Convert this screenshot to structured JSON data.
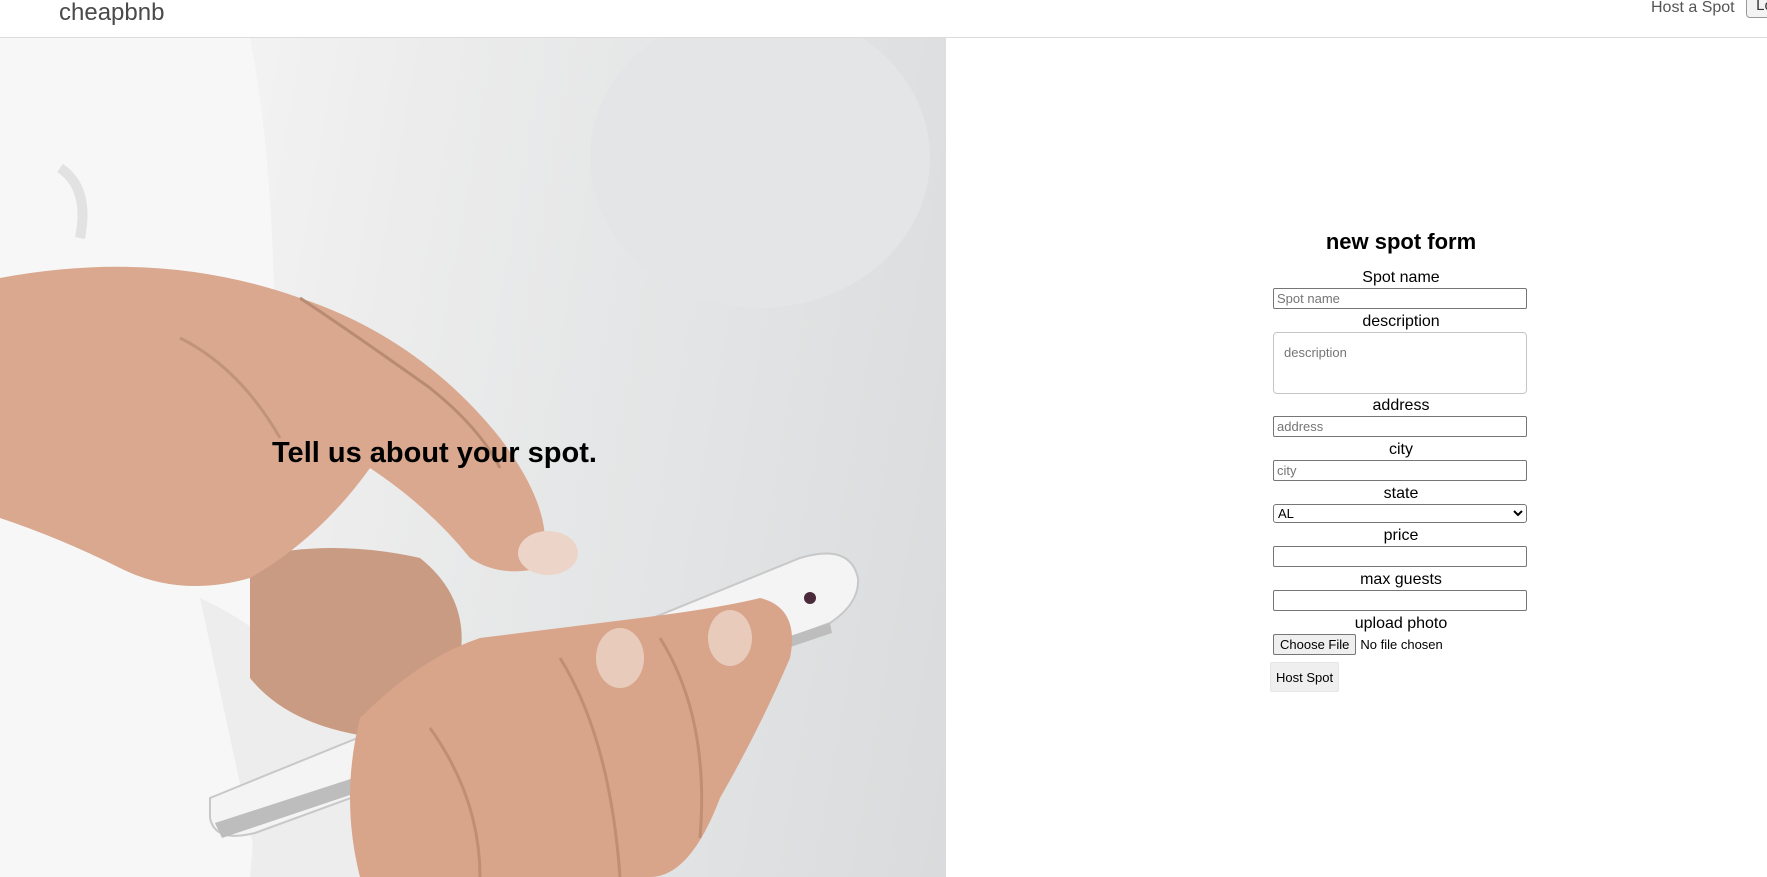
{
  "navbar": {
    "brand": "cheapbnb",
    "host_link": "Host a Spot",
    "trailing_button": "Lo"
  },
  "hero": {
    "headline": "Tell us about your spot."
  },
  "form": {
    "title": "new spot form",
    "spot_name": {
      "label": "Spot name",
      "placeholder": "Spot name",
      "value": ""
    },
    "description": {
      "label": "description",
      "placeholder": "description",
      "value": ""
    },
    "address": {
      "label": "address",
      "placeholder": "address",
      "value": ""
    },
    "city": {
      "label": "city",
      "placeholder": "city",
      "value": ""
    },
    "state": {
      "label": "state",
      "selected": "AL"
    },
    "price": {
      "label": "price",
      "value": ""
    },
    "max_guests": {
      "label": "max guests",
      "value": ""
    },
    "upload_photo": {
      "label": "upload photo",
      "button": "Choose File",
      "status": "No file chosen"
    },
    "submit": "Host Spot"
  }
}
